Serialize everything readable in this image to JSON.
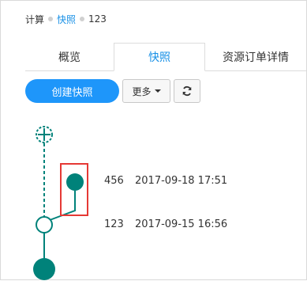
{
  "breadcrumb": [
    {
      "label": "计算",
      "link": false
    },
    {
      "label": "快照",
      "link": true
    },
    {
      "label": "123",
      "link": false
    }
  ],
  "tabs": [
    {
      "label": "概览",
      "active": false
    },
    {
      "label": "快照",
      "active": true
    },
    {
      "label": "资源订单详情",
      "active": false
    }
  ],
  "toolbar": {
    "create_label": "创建快照",
    "more_label": "更多",
    "refresh_icon": "refresh-icon"
  },
  "snapshots": [
    {
      "name": "456",
      "time": "2017-09-18 17:51"
    },
    {
      "name": "123",
      "time": "2017-09-15 16:56"
    }
  ],
  "colors": {
    "accent": "#1e96fa",
    "link": "#1890e6",
    "node": "#00827a",
    "highlight": "#e53935"
  }
}
